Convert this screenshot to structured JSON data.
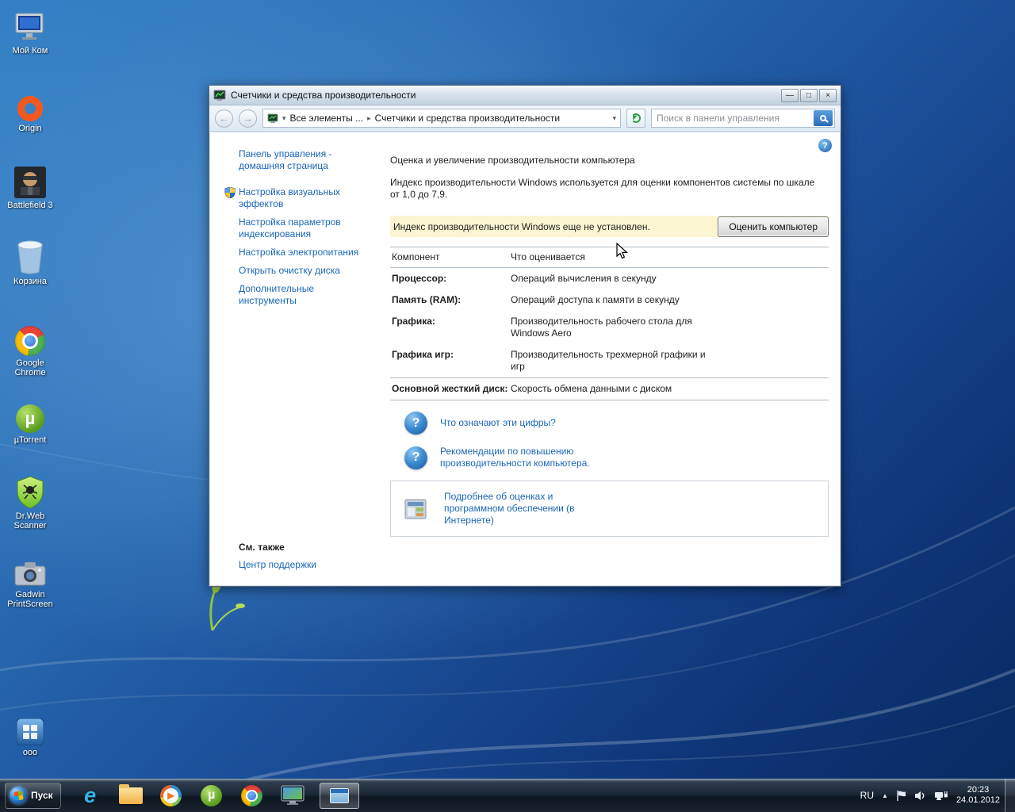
{
  "glyphs": {
    "minimize": "—",
    "maximize": "□",
    "close": "×",
    "back": "←",
    "forward": "→",
    "crumb_sep": "▸",
    "dropdown": "▾",
    "help": "?",
    "ie": "e",
    "mu": "µ",
    "play": "▶",
    "tray_expand": "▲"
  },
  "desktop": {
    "icons": [
      {
        "label": "Мой Ком"
      },
      {
        "label": "Origin"
      },
      {
        "label": "Battlefield 3"
      },
      {
        "label": "Корзина"
      },
      {
        "label": "Google Chrome"
      },
      {
        "label": "µTorrent"
      },
      {
        "label": "Dr.Web Scanner"
      },
      {
        "label": "Gadwin PrintScreen"
      },
      {
        "label": "ooo"
      }
    ]
  },
  "window": {
    "title": "Счетчики и средства производительности",
    "breadcrumb": {
      "root": "Все элементы ...",
      "current": "Счетчики и средства производительности"
    },
    "search": {
      "placeholder": "Поиск в панели управления"
    },
    "sidebar": {
      "items": [
        {
          "label": "Панель управления - домашняя страница"
        },
        {
          "label": "Настройка визуальных эффектов"
        },
        {
          "label": "Настройка параметров индексирования"
        },
        {
          "label": "Настройка электропитания"
        },
        {
          "label": "Открыть очистку диска"
        },
        {
          "label": "Дополнительные инструменты"
        }
      ],
      "see_also": "См. также",
      "see_also_links": [
        {
          "label": "Центр поддержки"
        }
      ]
    },
    "main": {
      "title": "Оценка и увеличение производительности компьютера",
      "description": "Индекс производительности Windows используется для оценки компонентов системы по шкале от 1,0 до 7,9.",
      "banner": {
        "text": "Индекс производительности Windows еще не установлен.",
        "button": "Оценить компьютер"
      },
      "table": {
        "headers": [
          "Компонент",
          "Что оценивается"
        ],
        "rows": [
          {
            "component": "Процессор:",
            "measure": "Операций вычисления в секунду"
          },
          {
            "component": "Память (RAM):",
            "measure": "Операций доступа к памяти в секунду"
          },
          {
            "component": "Графика:",
            "measure": "Производительность рабочего стола для Windows Aero"
          },
          {
            "component": "Графика игр:",
            "measure": "Производительность трехмерной графики и игр"
          },
          {
            "component": "Основной жесткий диск:",
            "measure": "Скорость обмена данными с диском"
          }
        ]
      },
      "links": [
        {
          "label": "Что означают эти цифры?"
        },
        {
          "label": "Рекомендации по повышению производительности компьютера."
        }
      ],
      "more_info": "Подробнее об оценках и программном обеспечении (в Интернете)"
    }
  },
  "taskbar": {
    "start_label": "Пуск",
    "buttons": [
      "internet-explorer",
      "windows-explorer",
      "media-player",
      "utorrent",
      "chrome",
      "display-app",
      "control-panel-active-window"
    ],
    "tray_icons": [
      "hidden-icons",
      "action-center-flag",
      "volume",
      "network"
    ],
    "tray": {
      "language": "RU",
      "time": "20:23",
      "date": "24.01.2012"
    }
  }
}
